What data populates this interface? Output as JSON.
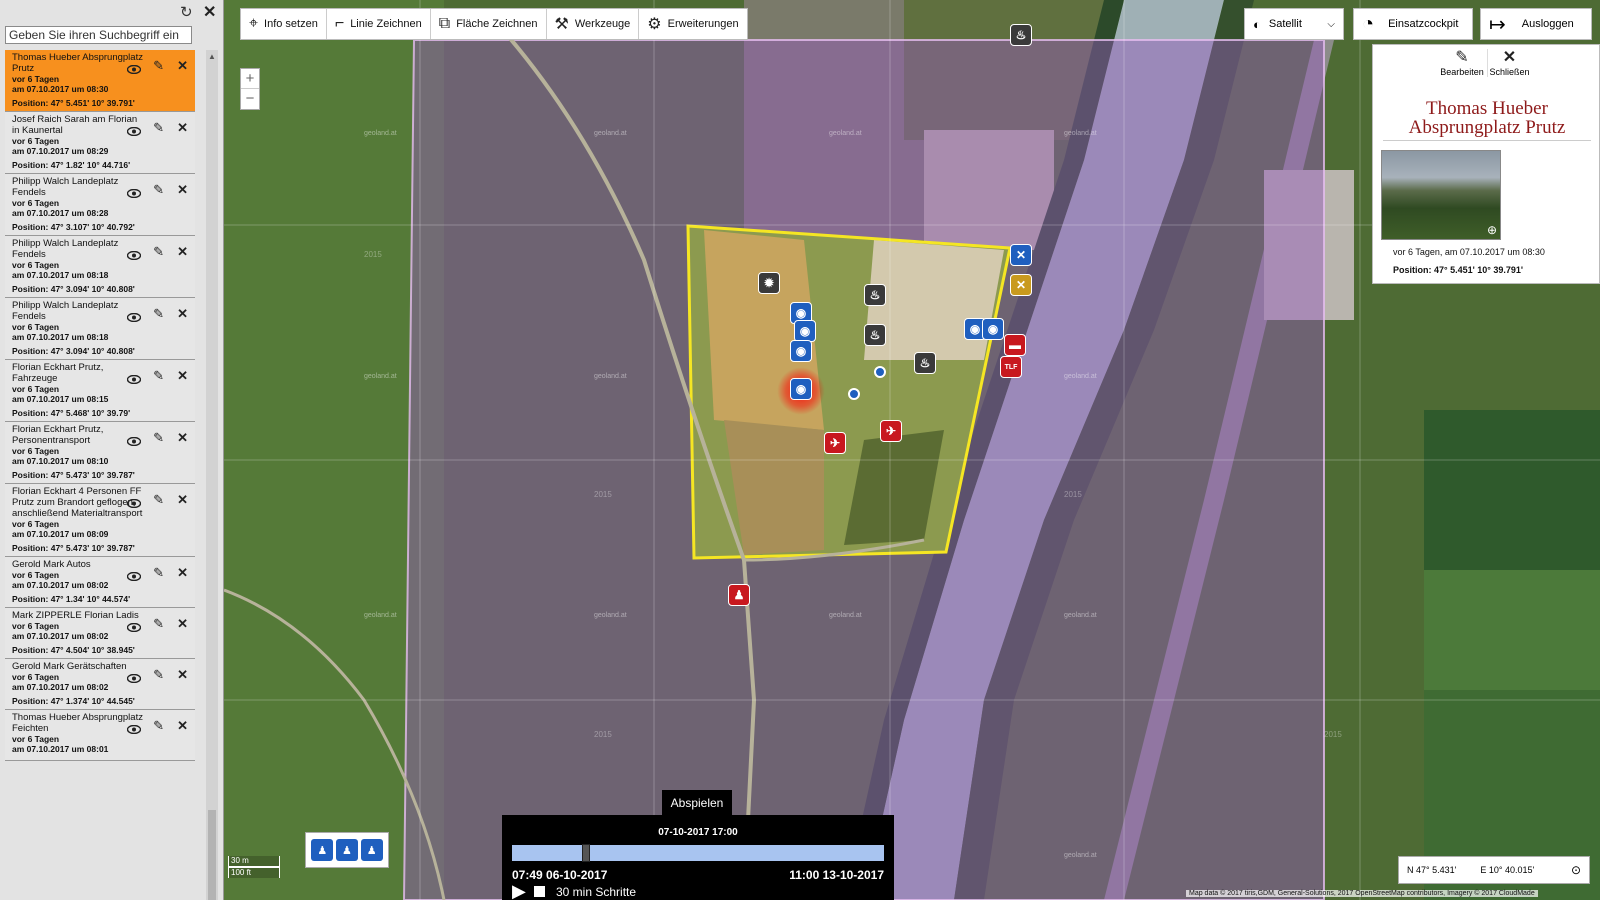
{
  "sidebar": {
    "search_placeholder": "Geben Sie ihren Suchbegriff ein",
    "refresh_icon": "refresh-icon",
    "close_icon": "close-icon",
    "entries": [
      {
        "title": "Thomas Hueber Absprungplatz Prutz",
        "ago": "vor 6 Tagen",
        "date": "am 07.10.2017 um 08:30",
        "position": "Position: 47° 5.451' 10° 39.791'",
        "active": true
      },
      {
        "title": "Josef Raich Sarah am Florian in Kaunertal",
        "ago": "vor 6 Tagen",
        "date": "am 07.10.2017 um 08:29",
        "position": "Position: 47° 1.82' 10° 44.716'"
      },
      {
        "title": "Philipp Walch Landeplatz Fendels",
        "ago": "vor 6 Tagen",
        "date": "am 07.10.2017 um 08:28",
        "position": "Position: 47° 3.107' 10° 40.792'"
      },
      {
        "title": "Philipp Walch Landeplatz Fendels",
        "ago": "vor 6 Tagen",
        "date": "am 07.10.2017 um 08:18",
        "position": "Position: 47° 3.094' 10° 40.808'"
      },
      {
        "title": "Philipp Walch Landeplatz Fendels",
        "ago": "vor 6 Tagen",
        "date": "am 07.10.2017 um 08:18",
        "position": "Position: 47° 3.094' 10° 40.808'"
      },
      {
        "title": "Florian Eckhart Prutz, Fahrzeuge",
        "ago": "vor 6 Tagen",
        "date": "am 07.10.2017 um 08:15",
        "position": "Position: 47° 5.468' 10° 39.79'"
      },
      {
        "title": "Florian Eckhart Prutz, Personentransport",
        "ago": "vor 6 Tagen",
        "date": "am 07.10.2017 um 08:10",
        "position": "Position: 47° 5.473' 10° 39.787'"
      },
      {
        "title": "Florian Eckhart 4 Personen FF Prutz zum Brandort geflogen, anschließend Materialtransport",
        "ago": "vor 6 Tagen",
        "date": "am 07.10.2017 um 08:09",
        "position": "Position: 47° 5.473' 10° 39.787'"
      },
      {
        "title": "Gerold Mark Autos",
        "ago": "vor 6 Tagen",
        "date": "am 07.10.2017 um 08:02",
        "position": "Position: 47° 1.34' 10° 44.574'"
      },
      {
        "title": "Mark ZIPPERLE Florian Ladis",
        "ago": "vor 6 Tagen",
        "date": "am 07.10.2017 um 08:02",
        "position": "Position: 47° 4.504' 10° 38.945'"
      },
      {
        "title": "Gerold Mark Gerätschaften",
        "ago": "vor 6 Tagen",
        "date": "am 07.10.2017 um 08:02",
        "position": "Position: 47° 1.374' 10° 44.545'"
      },
      {
        "title": "Thomas Hueber Absprungplatz Feichten",
        "ago": "vor 6 Tagen",
        "date": "am 07.10.2017 um 08:01",
        "position": ""
      }
    ]
  },
  "toolbar": {
    "info": "Info setzen",
    "line": "Linie Zeichnen",
    "area": "Fläche Zeichnen",
    "tools": "Werkzeuge",
    "extensions": "Erweiterungen"
  },
  "layer_select": {
    "value": "Satellit"
  },
  "cockpit": {
    "label": "Einsatzcockpit"
  },
  "logout": {
    "label": "Ausloggen"
  },
  "zoom": {
    "in": "+",
    "out": "−"
  },
  "info_panel": {
    "edit": "Bearbeiten",
    "close": "Schließen",
    "title": "Thomas Hueber Absprungplatz Prutz",
    "ago": "vor 6 Tagen, am 07.10.2017 um 08:30",
    "position": "Position: 47° 5.451' 10° 39.791'"
  },
  "map": {
    "watermark": "geoland.at",
    "year": "2015",
    "marker_labels": {
      "tlf": "TLF"
    }
  },
  "playback": {
    "tab": "Abspielen",
    "current": "07-10-2017 17:00",
    "start": "07:49 06-10-2017",
    "end": "11:00 13-10-2017",
    "step": "30 min Schritte",
    "position": 0.2
  },
  "scale": {
    "metric": "30 m",
    "imperial": "100 ft"
  },
  "coords": {
    "north": "N 47° 5.431'",
    "east": "E 10° 40.015'"
  },
  "attribution": "Map data © 2017 tiris,GDM, General-Solutions, 2017 OpenStreetMap contributors, Imagery © 2017 CloudMade"
}
